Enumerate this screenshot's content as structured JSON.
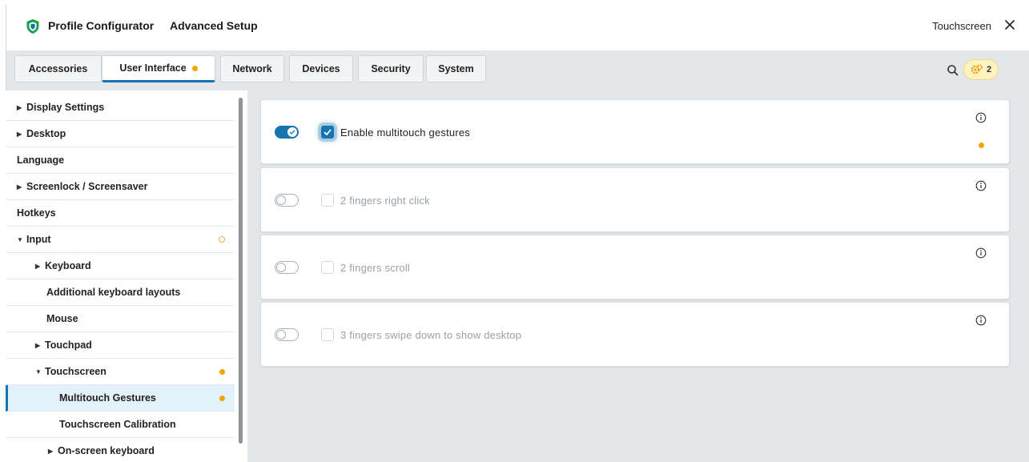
{
  "window": {
    "title": "Profile Configurator",
    "subtitle": "Advanced Setup",
    "context": "Touchscreen",
    "close_icon": "close-icon",
    "logo_icon": "shield-icon"
  },
  "tabs": [
    {
      "label": "Accessories",
      "active": false,
      "modified": false
    },
    {
      "label": "User Interface",
      "active": true,
      "modified": true
    },
    {
      "label": "Network",
      "active": false,
      "modified": false
    },
    {
      "label": "Devices",
      "active": false,
      "modified": false
    },
    {
      "label": "Security",
      "active": false,
      "modified": false
    },
    {
      "label": "System",
      "active": false,
      "modified": false
    }
  ],
  "toolbar": {
    "search_icon": "search-icon",
    "changes_badge": {
      "icon": "gear-changes-icon",
      "count": "2"
    }
  },
  "sidebar": {
    "items": [
      {
        "label": "Display Settings",
        "expandable": true,
        "expanded": false,
        "level": 0
      },
      {
        "label": "Desktop",
        "expandable": true,
        "expanded": false,
        "level": 0
      },
      {
        "label": "Language",
        "expandable": false,
        "level": 0
      },
      {
        "label": "Screenlock / Screensaver",
        "expandable": true,
        "expanded": false,
        "level": 0
      },
      {
        "label": "Hotkeys",
        "expandable": false,
        "level": 0
      },
      {
        "label": "Input",
        "expandable": true,
        "expanded": true,
        "level": 0,
        "indicator": "partial"
      },
      {
        "label": "Keyboard",
        "expandable": true,
        "expanded": false,
        "level": 1
      },
      {
        "label": "Additional keyboard layouts",
        "expandable": false,
        "level": 1
      },
      {
        "label": "Mouse",
        "expandable": false,
        "level": 1
      },
      {
        "label": "Touchpad",
        "expandable": true,
        "expanded": false,
        "level": 1
      },
      {
        "label": "Touchscreen",
        "expandable": true,
        "expanded": true,
        "level": 1,
        "indicator": "modified"
      },
      {
        "label": "Multitouch Gestures",
        "expandable": false,
        "level": 2,
        "selected": true,
        "indicator": "modified"
      },
      {
        "label": "Touchscreen Calibration",
        "expandable": false,
        "level": 2
      },
      {
        "label": "On-screen keyboard",
        "expandable": true,
        "expanded": false,
        "level": 1
      }
    ]
  },
  "settings": [
    {
      "label": "Enable multitouch gestures",
      "toggle_on": true,
      "checked": true,
      "enabled": true,
      "modified": true
    },
    {
      "label": "2 fingers right click",
      "toggle_on": false,
      "checked": false,
      "enabled": false,
      "modified": false
    },
    {
      "label": "2 fingers scroll",
      "toggle_on": false,
      "checked": false,
      "enabled": false,
      "modified": false
    },
    {
      "label": "3 fingers swipe down to show desktop",
      "toggle_on": false,
      "checked": false,
      "enabled": false,
      "modified": false
    }
  ],
  "colors": {
    "accent": "#1674b0",
    "modified_dot": "#f0a500",
    "background": "#e4e7ea",
    "selected_bg": "#e3f1fb"
  }
}
